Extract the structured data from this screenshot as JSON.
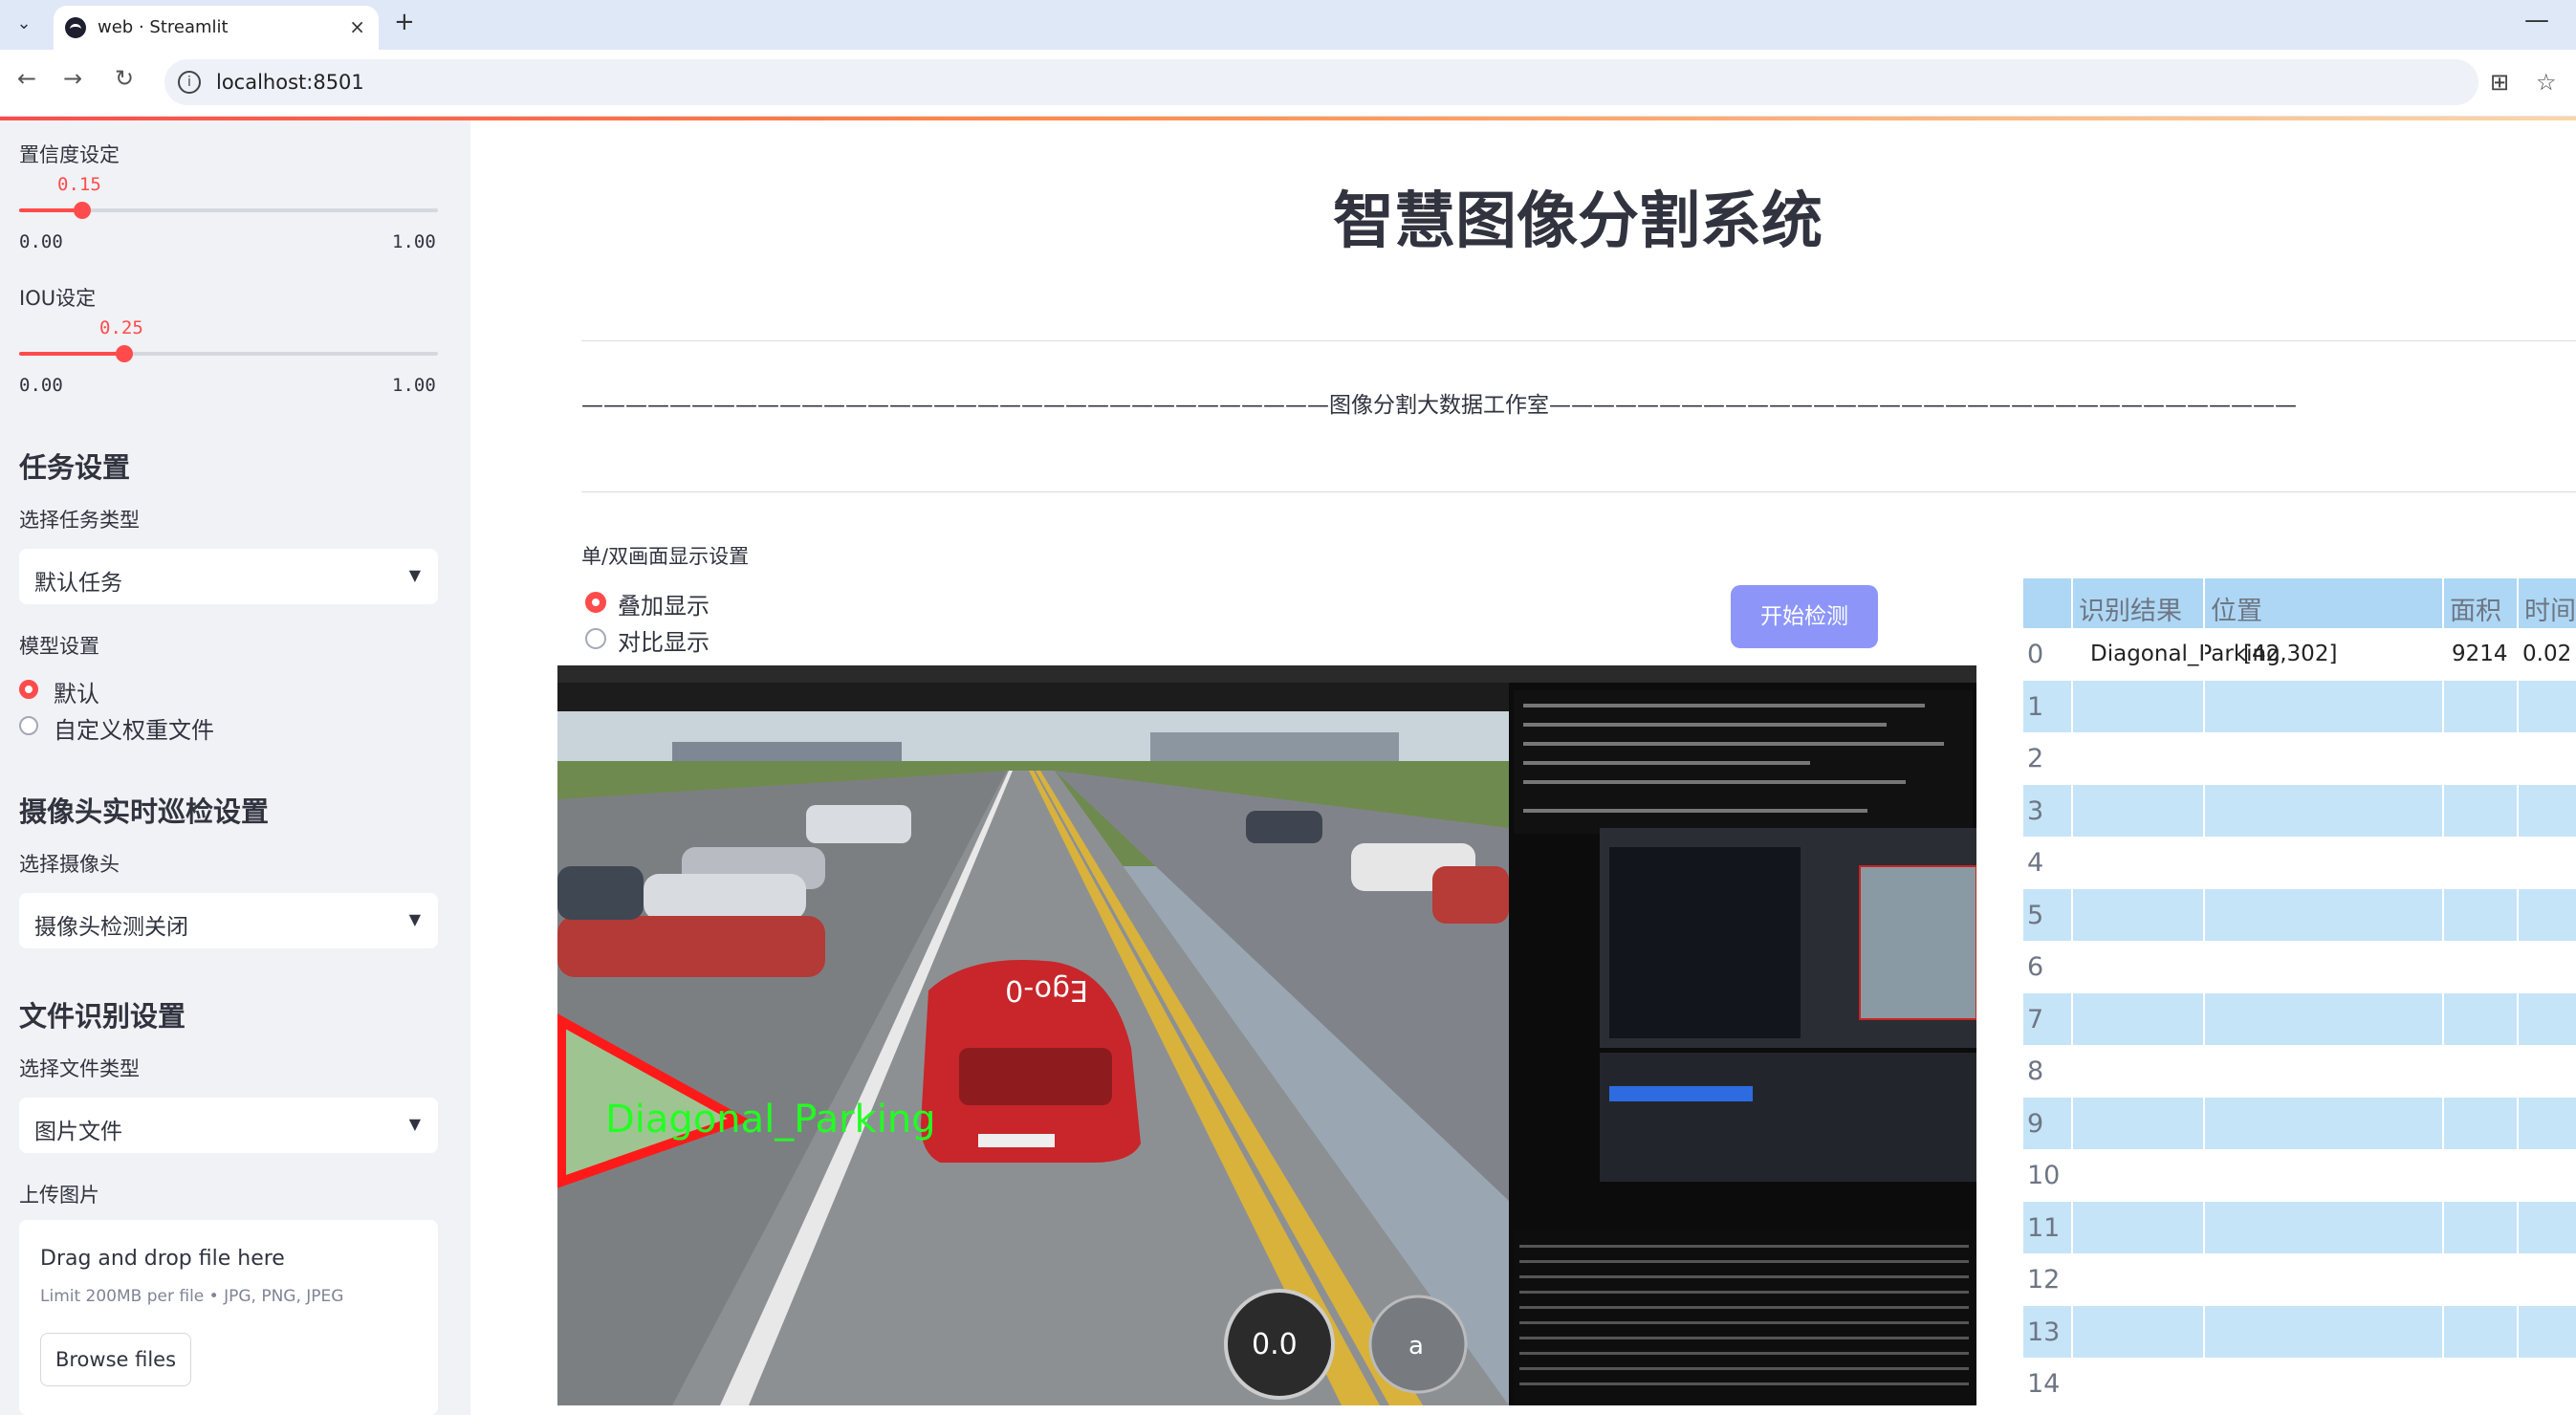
{
  "browser": {
    "tab_title": "web · Streamlit",
    "url": "localhost:8501",
    "new_tab": "+",
    "close_tab": "×",
    "minimize": "—"
  },
  "sidebar": {
    "confidence": {
      "label": "置信度设定",
      "value": "0.15",
      "min": "0.00",
      "max": "1.00",
      "fraction": 0.15
    },
    "iou": {
      "label": "IOU设定",
      "value": "0.25",
      "min": "0.00",
      "max": "1.00",
      "fraction": 0.25
    },
    "task_header": "任务设置",
    "task_type_label": "选择任务类型",
    "task_type_value": "默认任务",
    "model_label": "模型设置",
    "model_options": [
      "默认",
      "自定义权重文件"
    ],
    "model_selected": 0,
    "camera_header": "摄像头实时巡检设置",
    "camera_label": "选择摄像头",
    "camera_value": "摄像头检测关闭",
    "file_header": "文件识别设置",
    "file_type_label": "选择文件类型",
    "file_type_value": "图片文件",
    "upload_label": "上传图片",
    "upload_drag": "Drag and drop file here",
    "upload_limit": "Limit 200MB per file • JPG, PNG, JPEG",
    "upload_button": "Browse files"
  },
  "main": {
    "title": "智慧图像分割系统",
    "studio_line": "——————————————————————————————————图像分割大数据工作室——————————————————————————————————",
    "display_label": "单/双画面显示设置",
    "display_options": [
      "叠加显示",
      "对比显示"
    ],
    "display_selected": 0,
    "start_button": "开始检测",
    "detection_label": "Diagonal_Parking",
    "car_plate": "Ego-0",
    "speed_display": "0.0",
    "gear_display": "a"
  },
  "table": {
    "headers": [
      "识别结果",
      "位置",
      "面积",
      "时间"
    ],
    "rows": [
      {
        "idx": "0",
        "result": "Diagonal_Parking",
        "position": "[42,302]",
        "area": "9214",
        "time": "0.02"
      },
      {
        "idx": "1"
      },
      {
        "idx": "2"
      },
      {
        "idx": "3"
      },
      {
        "idx": "4"
      },
      {
        "idx": "5"
      },
      {
        "idx": "6"
      },
      {
        "idx": "7"
      },
      {
        "idx": "8"
      },
      {
        "idx": "9"
      },
      {
        "idx": "10"
      },
      {
        "idx": "11"
      },
      {
        "idx": "12"
      },
      {
        "idx": "13"
      },
      {
        "idx": "14"
      }
    ]
  },
  "colors": {
    "accent": "#ff4b4b",
    "sidebar_bg": "#f0f2f6",
    "button": "#8d96f8",
    "table_header": "#add7f4",
    "table_stripe": "#c6e4f8",
    "detection_box": "#ff1a1a",
    "detection_text": "#22ff22"
  }
}
